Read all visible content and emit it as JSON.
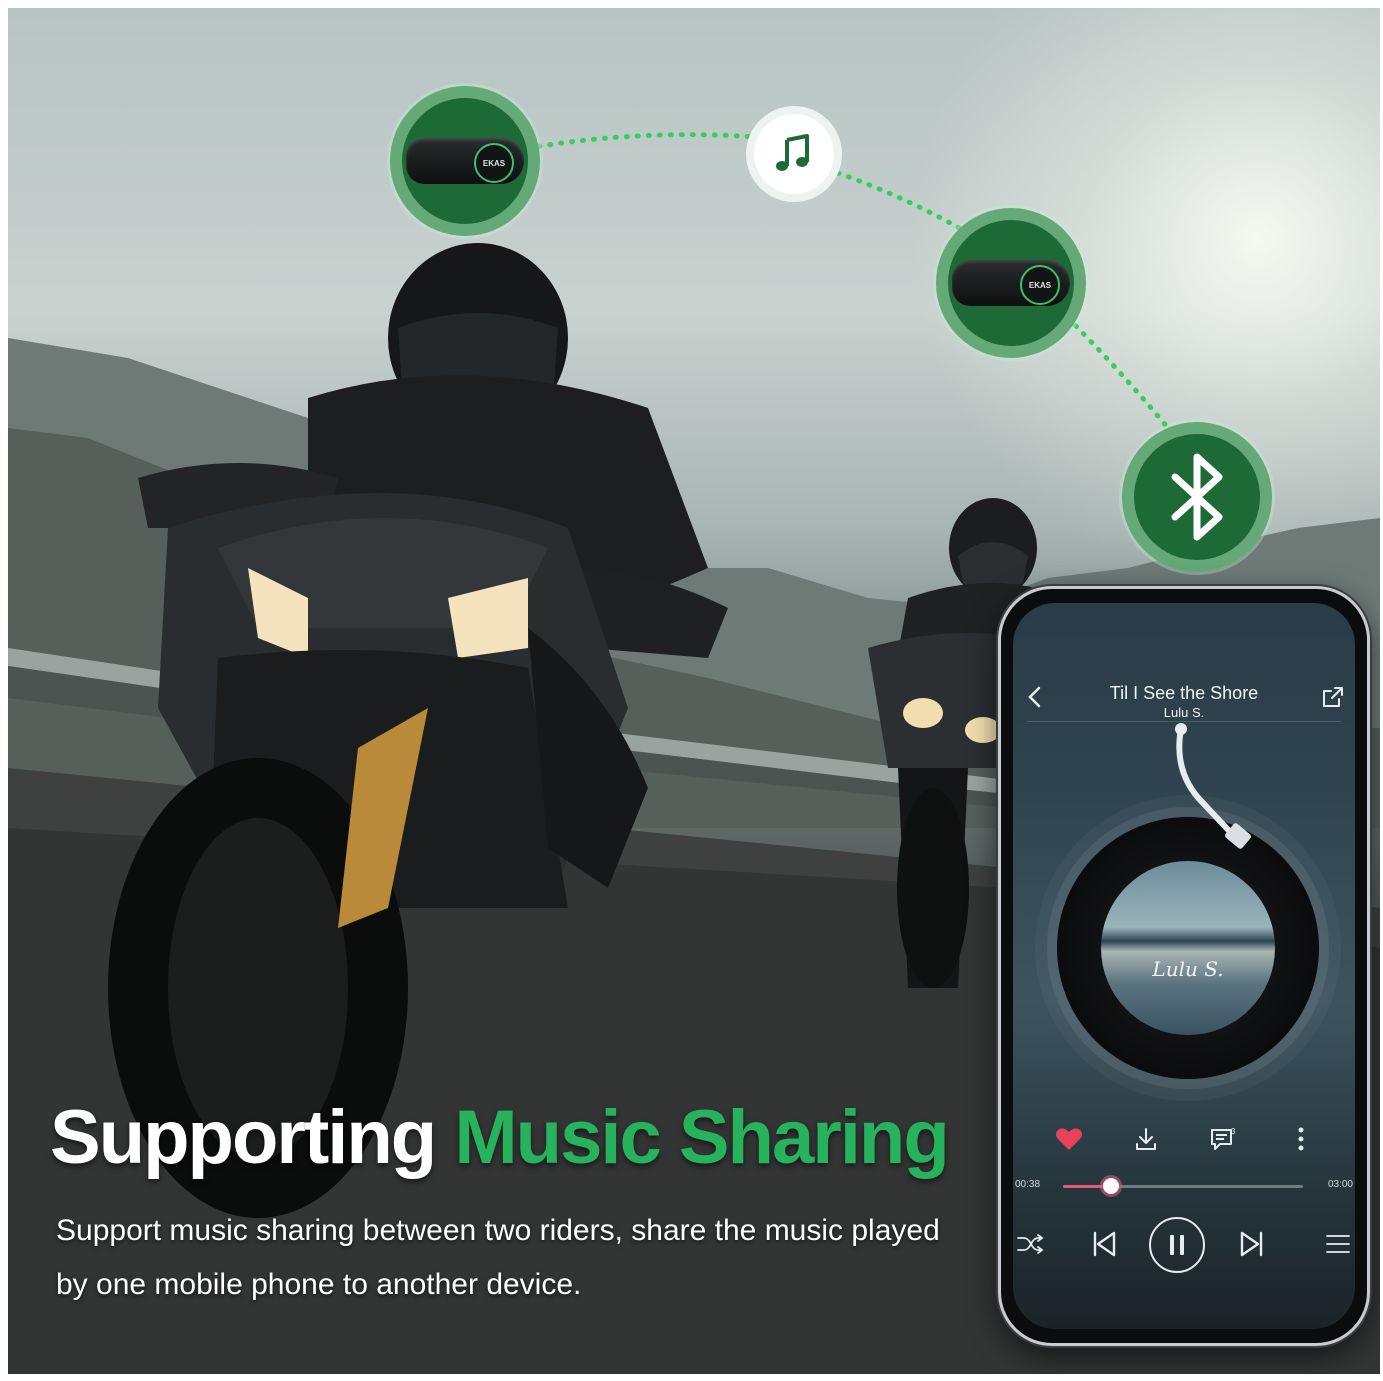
{
  "headline": {
    "part1": "Supporting ",
    "part2": "Music Sharing"
  },
  "description": "Support music sharing between two riders, share the music played by one mobile phone to another device.",
  "connection": {
    "device_label": "EKAS",
    "accent_color": "#1d6a36",
    "dot_color": "#3ccc5c"
  },
  "player": {
    "title": "Til I See the Shore",
    "artist": "Lulu S.",
    "album_art_text": "Lulu S.",
    "elapsed": "00:38",
    "total": "03:00",
    "progress": 0.2
  },
  "icons": {
    "back": "chevron-left-icon",
    "share": "share-icon",
    "like": "heart-icon",
    "download": "download-icon",
    "comments": "comment-icon",
    "more": "more-icon",
    "shuffle": "shuffle-icon",
    "previous": "skip-previous-icon",
    "pause": "pause-icon",
    "next": "skip-next-icon",
    "playlist": "playlist-icon",
    "music": "music-note-icon",
    "bluetooth": "bluetooth-icon"
  }
}
